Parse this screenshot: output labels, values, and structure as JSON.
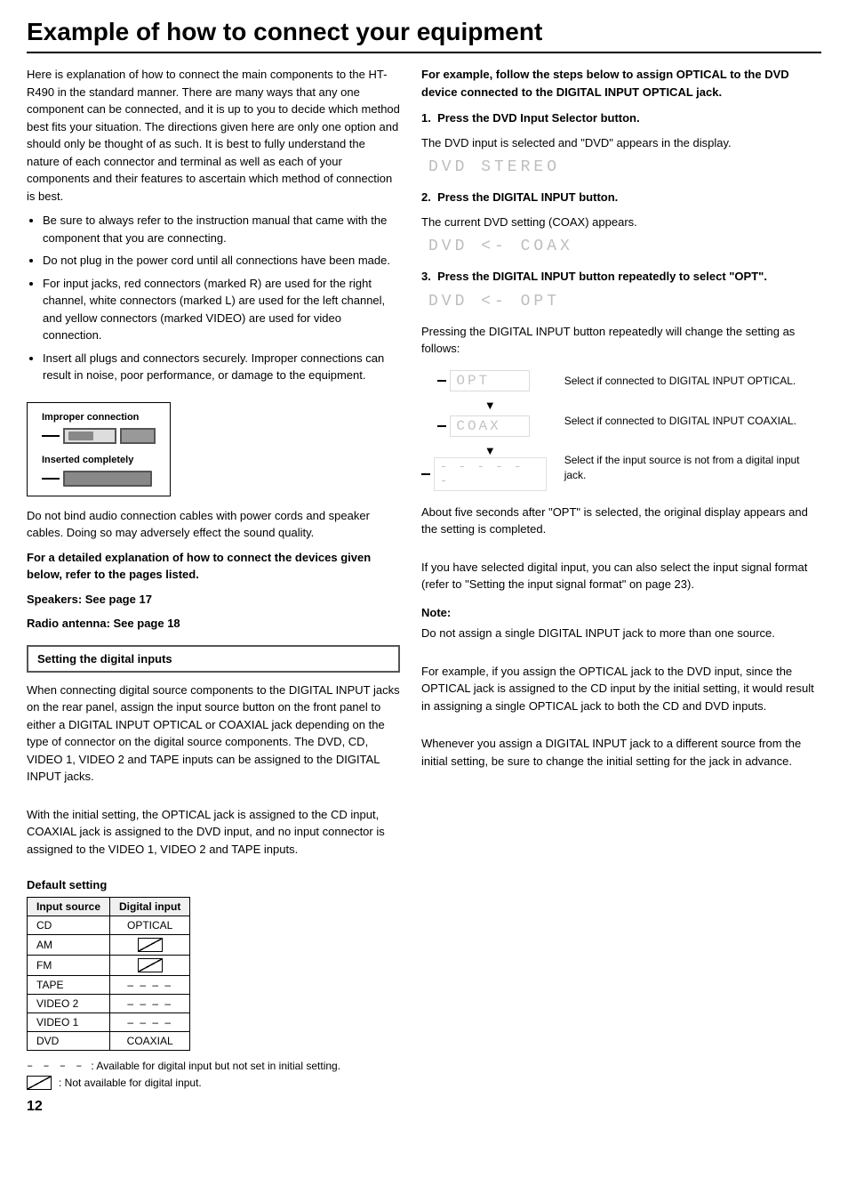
{
  "page": {
    "title": "Example of how to connect your equipment",
    "page_number": "12"
  },
  "left": {
    "intro": "Here is explanation of how to connect the main components to the HT-R490 in the standard manner. There are many ways that any one component can be connected, and it is up to you to decide which method best fits your situation. The directions given here are only one option and should only be thought of as such. It is best to fully understand the nature of each connector and terminal as well as each of your components and their features to ascertain which method of connection is best.",
    "bullets": [
      "Be sure to always refer to the instruction manual that came with the component that you are connecting.",
      "Do not plug in the power cord until all connections have been made.",
      "For input jacks, red connectors (marked R) are used for the right channel, white connectors (marked L) are used for the left channel, and yellow connectors (marked VIDEO) are used for video connection.",
      "Insert all plugs and connectors securely. Improper connections can result in noise, poor performance, or damage to the equipment."
    ],
    "connector_labels": {
      "improper": "Improper connection",
      "inserted": "Inserted completely"
    },
    "bind_note": "Do not bind audio connection cables with power cords and speaker cables. Doing so may adversely effect the sound quality.",
    "detailed_ref": "For a detailed explanation of how to connect the devices given below, refer to the pages listed.",
    "speakers_ref": "Speakers: See page 17",
    "radio_ref": "Radio antenna: See page 18",
    "section_box": "Setting the digital inputs",
    "digital_inputs_para1": "When connecting digital source components to the DIGITAL INPUT jacks on the rear panel, assign the input source button on the front panel to either a DIGITAL INPUT OPTICAL or COAXIAL jack depending on the type of connector on the digital source components. The DVD, CD, VIDEO 1, VIDEO 2 and TAPE inputs can be assigned to the DIGITAL INPUT jacks.",
    "digital_inputs_para2": "With the initial setting, the OPTICAL jack is assigned to the CD input, COAXIAL jack is assigned to the DVD input, and no input connector is assigned to the VIDEO 1, VIDEO 2 and TAPE inputs.",
    "default_setting_title": "Default setting",
    "table": {
      "headers": [
        "Input source",
        "Digital input"
      ],
      "rows": [
        {
          "source": "CD",
          "input": "OPTICAL"
        },
        {
          "source": "AM",
          "input": "diagonal"
        },
        {
          "source": "FM",
          "input": "diagonal"
        },
        {
          "source": "TAPE",
          "input": "----"
        },
        {
          "source": "VIDEO 2",
          "input": "----"
        },
        {
          "source": "VIDEO 1",
          "input": "----"
        },
        {
          "source": "DVD",
          "input": "COAXIAL"
        }
      ]
    },
    "legend": [
      {
        "symbol": "dashes",
        "meaning": ":  Available for digital input but not set in initial setting."
      },
      {
        "symbol": "diagonal",
        "meaning": ":  Not available for digital input."
      }
    ]
  },
  "right": {
    "intro_bold": "For example, follow the steps below to assign OPTICAL to the DVD device connected to the DIGITAL INPUT OPTICAL jack.",
    "steps": [
      {
        "number": "1.",
        "title": "Press the DVD Input Selector button.",
        "description": "The DVD input is selected and \"DVD\" appears in the display.",
        "display": "DVD   STEREO"
      },
      {
        "number": "2.",
        "title": "Press the DIGITAL INPUT button.",
        "description": "The current DVD setting (COAX) appears.",
        "display": "DVD  <-   COAX"
      },
      {
        "number": "3.",
        "title": "Press the DIGITAL INPUT button repeatedly to select \"OPT\".",
        "display": "DVD  <-   OPT"
      }
    ],
    "flow_description": "Pressing the DIGITAL INPUT button repeatedly will change the setting as follows:",
    "flow_items": [
      {
        "display": "OPT",
        "desc": "Select if connected to DIGITAL INPUT OPTICAL."
      },
      {
        "display": "COAX",
        "desc": "Select if connected to DIGITAL INPUT COAXIAL."
      },
      {
        "display": "- - - - -",
        "desc": "Select if the input source is not from a digital input jack."
      }
    ],
    "after_flow_1": "About five seconds after \"OPT\" is selected, the original display appears and the setting is completed.",
    "after_flow_2": "If you have selected digital input, you can also select the input signal format (refer to \"Setting the input signal format\" on page 23).",
    "note_title": "Note:",
    "notes": [
      "Do not assign a single DIGITAL INPUT jack to more than one source.",
      "For example, if you assign the OPTICAL jack to the DVD input, since the OPTICAL jack is assigned to the CD input by the initial setting, it would result in assigning a single OPTICAL jack to both the CD and DVD inputs.",
      "Whenever you assign a DIGITAL INPUT jack to a different source from the initial setting, be sure to change the initial setting for the jack in advance."
    ]
  }
}
